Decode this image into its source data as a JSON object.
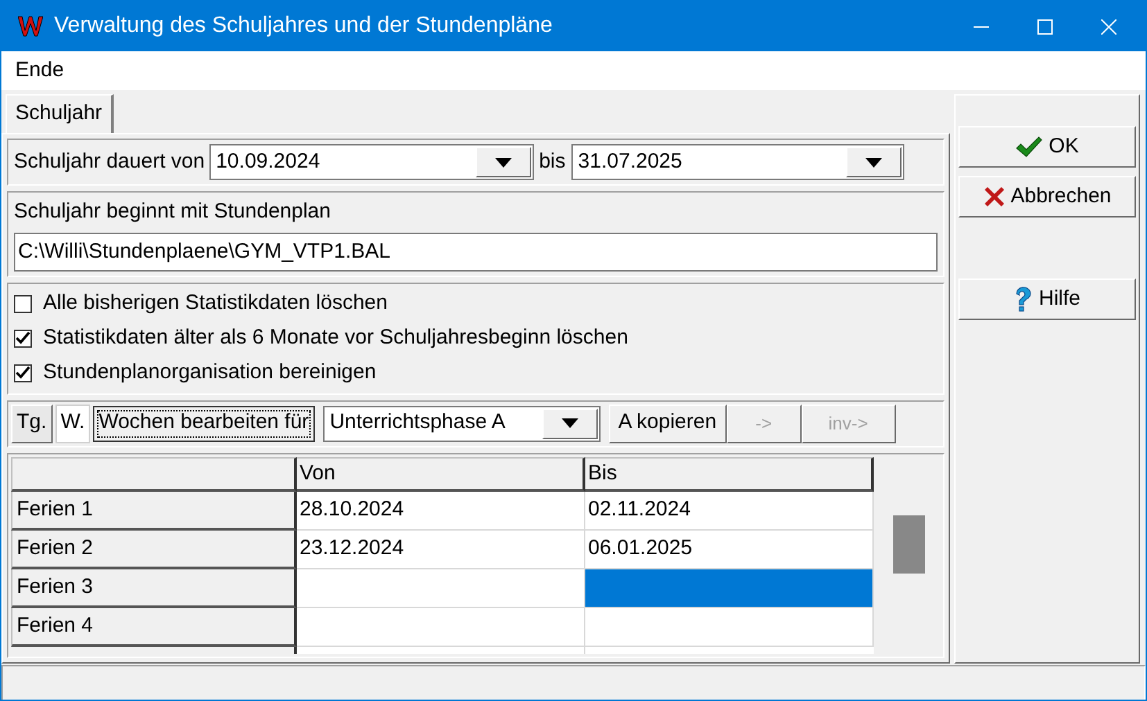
{
  "window": {
    "title": "Verwaltung des Schuljahres und der Stundenpläne"
  },
  "menu": [
    {
      "label": "Ende"
    }
  ],
  "tabs": [
    {
      "label": "Schuljahr",
      "selected": true
    }
  ],
  "duration": {
    "label_from": "Schuljahr dauert von",
    "from": "10.09.2024",
    "label_to": "bis",
    "to": "31.07.2025"
  },
  "timetable": {
    "label": "Schuljahr beginnt mit Stundenplan",
    "value": "C:\\Willi\\Stundenplaene\\GYM_VTP1.BAL"
  },
  "options": [
    {
      "label": "Alle bisherigen Statistikdaten löschen",
      "checked": false
    },
    {
      "label": "Statistikdaten älter als 6 Monate vor Schuljahresbeginn löschen",
      "checked": true
    },
    {
      "label": "Stundenplanorganisation bereinigen",
      "checked": true
    }
  ],
  "view_tabs": [
    {
      "label": "Tg.",
      "selected": false
    },
    {
      "label": "W.",
      "selected": true
    }
  ],
  "toolbar": {
    "edit_button": "Wochen bearbeiten für",
    "phase": "Unterrichtsphase A",
    "buttons": [
      {
        "label": "A kopieren",
        "disabled": false
      },
      {
        "label": "->",
        "disabled": true
      },
      {
        "label": "inv->",
        "disabled": true
      }
    ]
  },
  "table": {
    "columns": [
      "Von",
      "Bis"
    ],
    "rows": [
      {
        "label": "Ferien 1",
        "cells": [
          {
            "text": "28.10.2024",
            "selected": false
          },
          {
            "text": "02.11.2024",
            "selected": false
          }
        ]
      },
      {
        "label": "Ferien 2",
        "cells": [
          {
            "text": "23.12.2024",
            "selected": false
          },
          {
            "text": "06.01.2025",
            "selected": false
          }
        ]
      },
      {
        "label": "Ferien 3",
        "cells": [
          {
            "selected": false
          },
          {
            "selected": true
          }
        ]
      },
      {
        "label": "Ferien 4",
        "cells": [
          {
            "selected": false
          },
          {
            "selected": false
          }
        ]
      }
    ]
  },
  "buttons": [
    {
      "label": "OK",
      "kind": "ok"
    },
    {
      "label": "Abbrechen",
      "kind": "cancel"
    },
    {
      "label": "Hilfe",
      "kind": "help"
    }
  ]
}
